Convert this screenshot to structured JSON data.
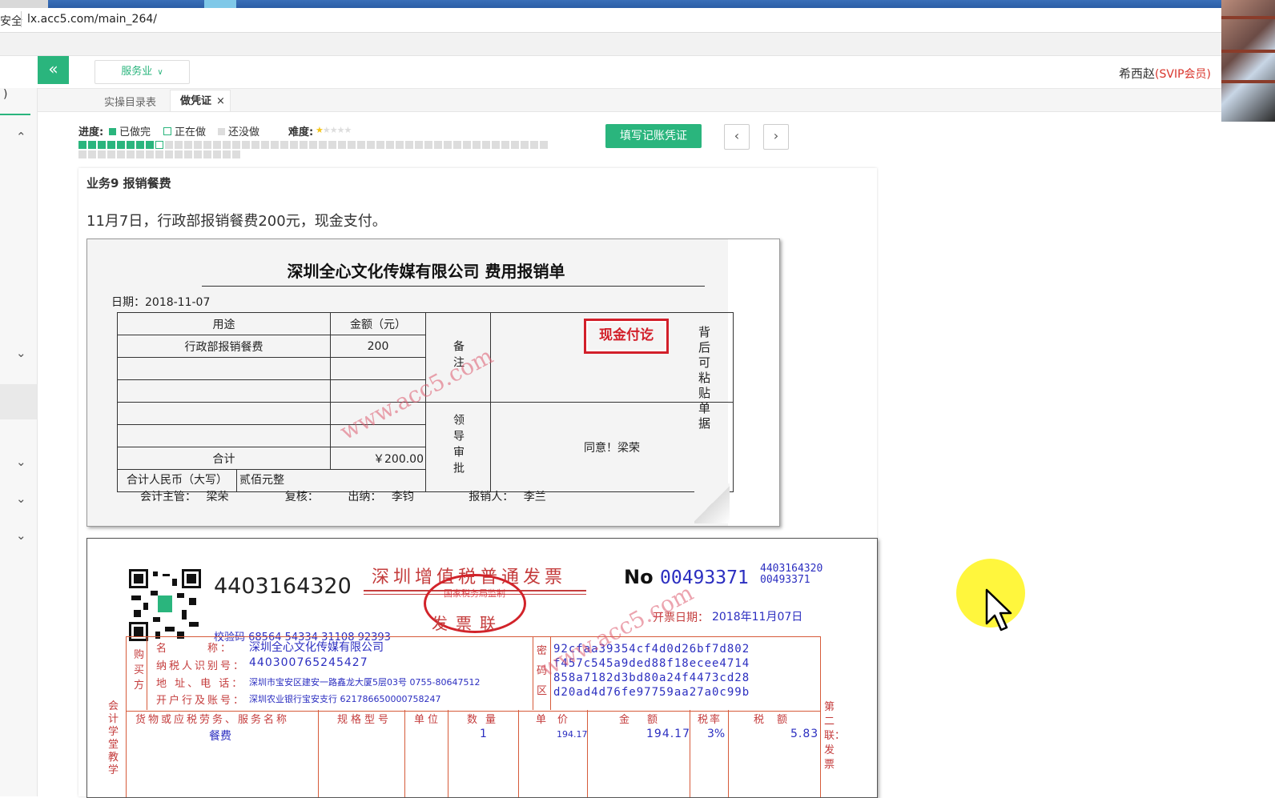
{
  "browser": {
    "security_label": "安全",
    "url": "lx.acc5.com/main_264/"
  },
  "header": {
    "collapse_glyph": "«",
    "industry_select": "服务业",
    "user_name": "希西赵",
    "user_badge": "(SVIP会员)"
  },
  "sidebar": {
    "paren": ")"
  },
  "tabs": [
    {
      "label": "实操目录表"
    },
    {
      "label": "做凭证",
      "close": "×"
    }
  ],
  "progress": {
    "label": "进度:",
    "legend_done": "已做完",
    "legend_doing": "正在做",
    "legend_todo": "还没做",
    "difficulty_label": "难度:",
    "difficulty_level": 1,
    "difficulty_max": 5,
    "done_count": 8,
    "current_index": 9,
    "total_count": 66,
    "colors": {
      "done": "#2ab57d",
      "doing": "#ffffff",
      "todo": "#dddddd"
    }
  },
  "actions": {
    "fill_voucher": "填写记账凭证",
    "prev": "‹",
    "next": "›"
  },
  "business": {
    "title": "业务9 报销餐费",
    "desc": "11月7日，行政部报销餐费200元，现金支付。"
  },
  "expense_form": {
    "title": "深圳全心文化传媒有限公司 费用报销单",
    "date": "日期：2018-11-07",
    "col_purpose": "用途",
    "col_amount": "金额（元）",
    "row1_purpose": "行政部报销餐费",
    "row1_amount": "200",
    "total_label": "合计",
    "total_amount": "￥200.00",
    "rmb_label": "合计人民币（大写）",
    "rmb_value": "贰佰元整",
    "remark_label": "备注",
    "leader_label": "领导审批",
    "approval": "同意！梁荣",
    "stamp": "现金付讫",
    "back_note": "背后可粘贴单据",
    "sig_manager_label": "会计主管：",
    "sig_manager": "梁荣",
    "sig_review_label": "复核：",
    "sig_cashier_label": "出纳：",
    "sig_cashier": "李钧",
    "sig_claimant_label": "报销人：",
    "sig_claimant": "李兰",
    "watermark": "www.acc5.com"
  },
  "invoice": {
    "code": "4403164320",
    "check_code": "校验码 68564 54334 31108 92393",
    "title": "深圳增值税普通发票",
    "copy_name": "发票联",
    "no_label": "No",
    "no_value": "00493371",
    "no_small_code": "4403164320",
    "no_small_value": "00493371",
    "issue_date_label": "开票日期：",
    "issue_date": "2018年11月07日",
    "buyer_side_label": "购买方",
    "buyer_name_label": "名　　　称：",
    "buyer_name": "深圳全心文化传媒有限公司",
    "buyer_tax_label": "纳税人识别号：",
    "buyer_tax": "440300765245427",
    "buyer_addr_label": "地 址、电 话：",
    "buyer_addr": "深圳市宝安区建安一路鑫龙大厦5层03号 0755-80647512",
    "buyer_bank_label": "开户行及账号：",
    "buyer_bank": "深圳农业银行宝安支行 621786650000758247",
    "cipher_label": "密码区",
    "cipher_lines": [
      "92cfaa39354cf4d0d26bf7d802",
      "f457c545a9ded88f18ecee4714",
      "858a7182d3bd80a24f4473cd28",
      "d20ad4d76fe97759aa27a0c99b"
    ],
    "hdr_goods": "货物或应税劳务、服务名称",
    "hdr_spec": "规格型号",
    "hdr_unit": "单位",
    "hdr_qty": "数量",
    "hdr_price": "单价",
    "hdr_amount": "金额",
    "hdr_rate": "税率",
    "hdr_tax": "税额",
    "item_name": "餐费",
    "item_qty": "1",
    "item_price": "194.17",
    "item_amount": "194.17",
    "item_rate": "3%",
    "item_tax": "5.83",
    "left_vert": "会计学堂教学",
    "right_vert": "第二联：发票",
    "seal_text": "国家税务局监制"
  }
}
